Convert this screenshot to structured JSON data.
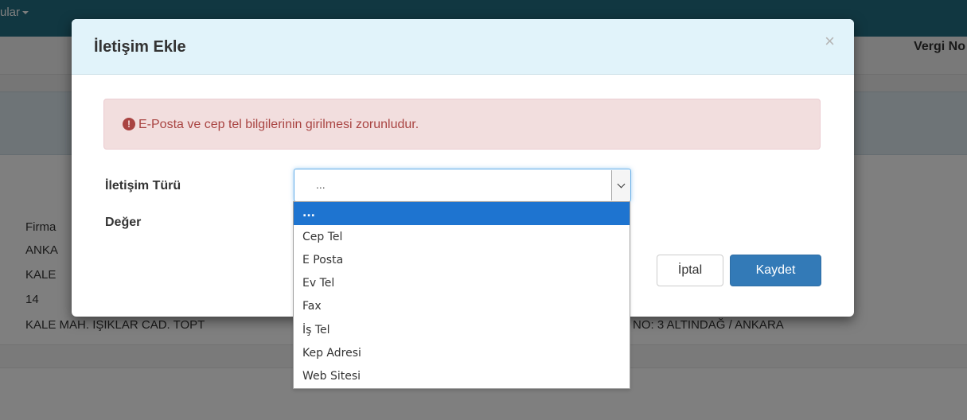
{
  "background": {
    "nav_text": "ular",
    "header_right": "Vergi No",
    "lines": [
      "Firma",
      "ANKA",
      "KALE",
      "14",
      "KALE MAH. IŞIKLAR CAD. TOPT",
      "NO: 3 ALTINDAĞ / ANKARA"
    ]
  },
  "modal": {
    "title": "İletişim Ekle",
    "close": "×",
    "alert": {
      "icon": "exclamation-circle-icon",
      "icon_glyph": "!",
      "text": "E-Posta ve cep tel bilgilerinin girilmesi zorunludur."
    },
    "fields": {
      "type_label": "İletişim Türü",
      "value_label": "Değer",
      "type_selected": "..."
    },
    "buttons": {
      "cancel": "İptal",
      "save": "Kaydet"
    }
  },
  "dropdown": {
    "options": [
      "...",
      "Cep Tel",
      "E Posta",
      "Ev Tel",
      "Fax",
      "İş Tel",
      "Kep Adresi",
      "Web Sitesi"
    ],
    "selected_index": 0
  },
  "colors": {
    "navbar": "#236f82",
    "modal_header": "#e1f3fa",
    "alert_bg": "#f2dede",
    "alert_text": "#a94442",
    "primary": "#337ab7",
    "dropdown_highlight": "#1e74d0"
  }
}
